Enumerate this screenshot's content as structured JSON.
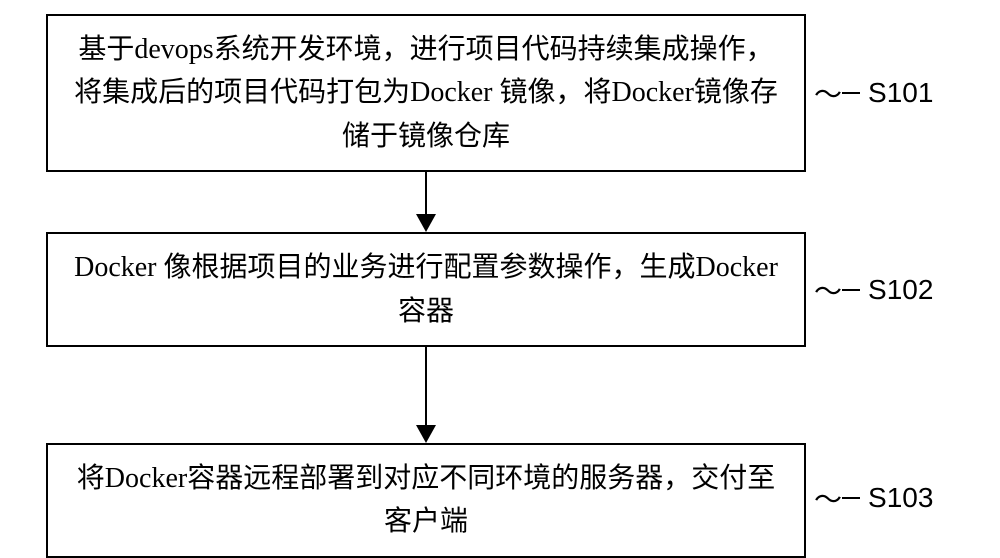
{
  "steps": [
    {
      "id": "S101",
      "text": "基于devops系统开发环境，进行项目代码持续集成操作，将集成后的项目代码打包为Docker 镜像，将Docker镜像存储于镜像仓库"
    },
    {
      "id": "S102",
      "text": "Docker 像根据项目的业务进行配置参数操作，生成Docker容器"
    },
    {
      "id": "S103",
      "text": "将Docker容器远程部署到对应不同环境的服务器，交付至客户端"
    }
  ]
}
